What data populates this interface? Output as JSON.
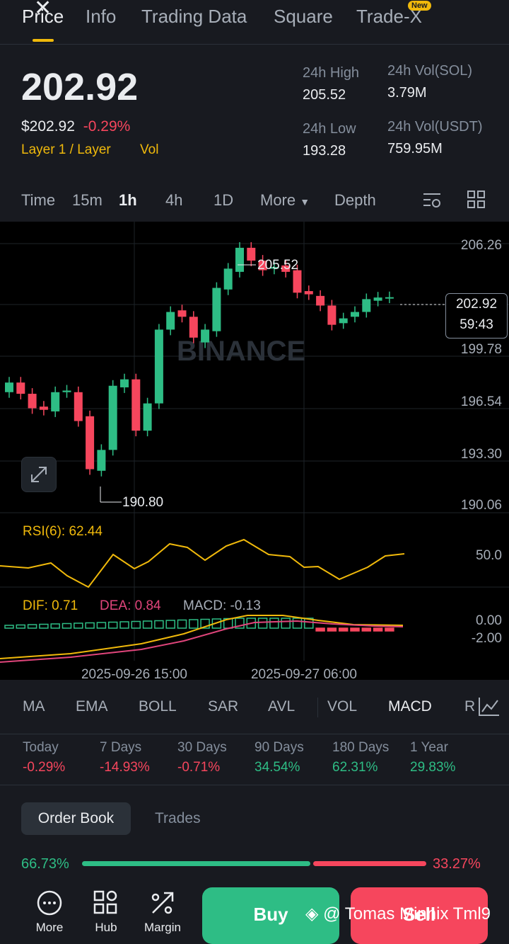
{
  "tabs": [
    {
      "label": "Price"
    },
    {
      "label": "Info"
    },
    {
      "label": "Trading Data"
    },
    {
      "label": "Square"
    },
    {
      "label": "Trade-X"
    }
  ],
  "new_badge": "New",
  "price": {
    "last": "202.92",
    "usd": "$202.92",
    "change": "-0.29%",
    "category": "Layer 1 / Layer",
    "vol_tag": "Vol"
  },
  "stats": {
    "high_label": "24h High",
    "high": "205.52",
    "low_label": "24h Low",
    "low": "193.28",
    "vol_sol_label": "24h Vol(SOL)",
    "vol_sol": "3.79M",
    "vol_usdt_label": "24h Vol(USDT)",
    "vol_usdt": "759.95M"
  },
  "timeframes": {
    "time": "Time",
    "m15": "15m",
    "h1": "1h",
    "h4": "4h",
    "d1": "1D",
    "more": "More",
    "depth": "Depth"
  },
  "chart": {
    "price_ticks": [
      "206.26",
      "199.78",
      "196.54",
      "193.30",
      "190.06"
    ],
    "current_label": "202.92",
    "countdown": "59:43",
    "high_marker": "205.52",
    "low_marker": "190.80",
    "watermark": "BINANCE",
    "rsi_label": "RSI(6): 62.44",
    "rsi_tick": "50.0",
    "dif_label": "DIF: 0.71",
    "dea_label": "DEA: 0.84",
    "macd_label": "MACD: -0.13",
    "macd_tick_top": "0.00",
    "macd_tick_bottom": "-2.00",
    "date1": "2025-09-26 15:00",
    "date2": "2025-09-27 06:00"
  },
  "chart_data": {
    "type": "candlestick",
    "candles": [
      {
        "o": 197.0,
        "c": 197.6
      },
      {
        "o": 197.6,
        "c": 196.9
      },
      {
        "o": 196.9,
        "c": 196.0
      },
      {
        "o": 196.1,
        "c": 195.9
      },
      {
        "o": 195.8,
        "c": 197.0
      },
      {
        "o": 197.0,
        "c": 197.1
      },
      {
        "o": 197.0,
        "c": 195.2
      },
      {
        "o": 195.5,
        "c": 192.2
      },
      {
        "o": 192.1,
        "c": 193.4
      },
      {
        "o": 193.4,
        "c": 197.4
      },
      {
        "o": 197.3,
        "c": 197.8
      },
      {
        "o": 197.8,
        "c": 194.6
      },
      {
        "o": 194.6,
        "c": 196.3
      },
      {
        "o": 196.3,
        "c": 200.9
      },
      {
        "o": 200.9,
        "c": 202.0
      },
      {
        "o": 202.1,
        "c": 201.7
      },
      {
        "o": 201.7,
        "c": 200.4
      },
      {
        "o": 200.1,
        "c": 200.9
      },
      {
        "o": 200.8,
        "c": 203.5
      },
      {
        "o": 203.4,
        "c": 204.7
      },
      {
        "o": 204.5,
        "c": 206.0
      },
      {
        "o": 206.0,
        "c": 205.2
      },
      {
        "o": 205.2,
        "c": 204.6
      },
      {
        "o": 204.7,
        "c": 204.8
      },
      {
        "o": 204.9,
        "c": 204.5
      },
      {
        "o": 204.6,
        "c": 203.2
      },
      {
        "o": 203.3,
        "c": 203.1
      },
      {
        "o": 203.0,
        "c": 202.4
      },
      {
        "o": 202.4,
        "c": 201.2
      },
      {
        "o": 201.3,
        "c": 201.6
      },
      {
        "o": 201.7,
        "c": 202.0
      },
      {
        "o": 202.0,
        "c": 202.8
      },
      {
        "o": 202.7,
        "c": 202.9
      },
      {
        "o": 202.9,
        "c": 202.92
      }
    ],
    "ylim": [
      190.06,
      206.26
    ]
  },
  "indicators": [
    "MA",
    "EMA",
    "BOLL",
    "SAR",
    "AVL",
    "VOL",
    "MACD",
    "R"
  ],
  "performance": [
    {
      "label": "Today",
      "value": "-0.29%"
    },
    {
      "label": "7 Days",
      "value": "-14.93%"
    },
    {
      "label": "30 Days",
      "value": "-0.71%"
    },
    {
      "label": "90 Days",
      "value": "34.54%"
    },
    {
      "label": "180 Days",
      "value": "62.31%"
    },
    {
      "label": "1 Year",
      "value": "29.83%"
    }
  ],
  "orderbook": {
    "tab_book": "Order Book",
    "tab_trades": "Trades",
    "bid_pct": "66.73%",
    "ask_pct": "33.27%",
    "bid_fraction": 0.6673
  },
  "nav": {
    "more": "More",
    "hub": "Hub",
    "margin": "Margin",
    "buy": "Buy",
    "sell": "Sell"
  },
  "watermark_user": "@ Tomas Minnix Tml9",
  "colors": {
    "green": "#2ebd85",
    "red": "#f6465d",
    "yellow": "#f0b90b"
  }
}
